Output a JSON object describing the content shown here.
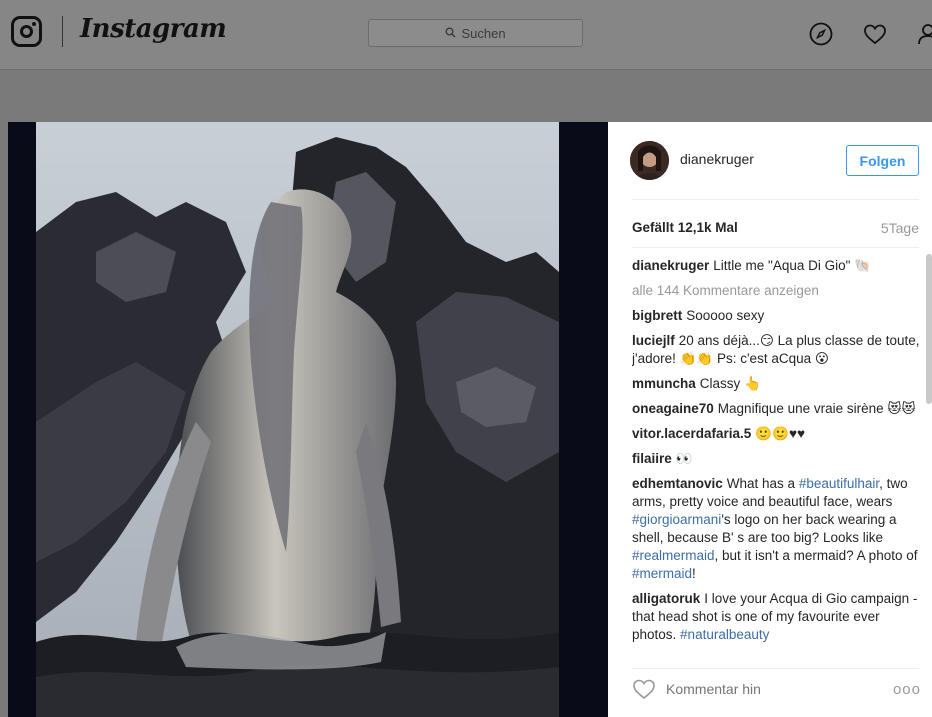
{
  "header": {
    "logo_text": "Instagram",
    "search_placeholder": "Suchen",
    "icons": [
      "explore-compass-icon",
      "activity-heart-icon",
      "profile-person-icon"
    ]
  },
  "post": {
    "username": "dianekruger",
    "follow_label": "Folgen",
    "likes": "Gefällt 12,1k Mal",
    "age": "5Tage",
    "comments": [
      {
        "user": "dianekruger",
        "parts": [
          {
            "t": "Little me \"Aqua Di Gio\" 🐚"
          }
        ]
      },
      {
        "view_all": "alle 144 Kommentare anzeigen"
      },
      {
        "user": "bigbrett",
        "parts": [
          {
            "t": "Sooooo sexy"
          }
        ]
      },
      {
        "user": "luciejlf",
        "parts": [
          {
            "t": "20 ans déjà...😏 La plus classe de toute, j'adore! 👏👏 Ps: c'est aCqua 😮"
          }
        ]
      },
      {
        "user": "mmuncha",
        "parts": [
          {
            "t": "Classy 👆"
          }
        ]
      },
      {
        "user": "oneagaine70",
        "parts": [
          {
            "t": "Magnifique une vraie sirène 😻😻"
          }
        ]
      },
      {
        "user": "vitor.lacerdafaria.5",
        "parts": [
          {
            "t": "🙂🙂♥♥"
          }
        ]
      },
      {
        "user": "filaiire",
        "parts": [
          {
            "t": "👀"
          }
        ]
      },
      {
        "user": "edhemtanovic",
        "parts": [
          {
            "t": "What has a "
          },
          {
            "t": "#beautifulhair",
            "tag": true
          },
          {
            "t": ", two arms, pretty voice and beautiful face, wears "
          },
          {
            "t": "#giorgioarmani",
            "tag": true
          },
          {
            "t": "'s logo on her back wearing a shell, because B' s are too big? Looks like "
          },
          {
            "t": "#realmermaid",
            "tag": true
          },
          {
            "t": ", but it isn't a mermaid? A photo of "
          },
          {
            "t": "#mermaid",
            "tag": true
          },
          {
            "t": "!"
          }
        ]
      },
      {
        "user": "alligatoruk",
        "parts": [
          {
            "t": "I love your Acqua di Gio campaign - that head shot is one of my favourite ever photos. "
          },
          {
            "t": "#naturalbeauty",
            "tag": true
          }
        ]
      }
    ],
    "comment_placeholder": "Kommentar hin",
    "more_label": "ooo"
  }
}
